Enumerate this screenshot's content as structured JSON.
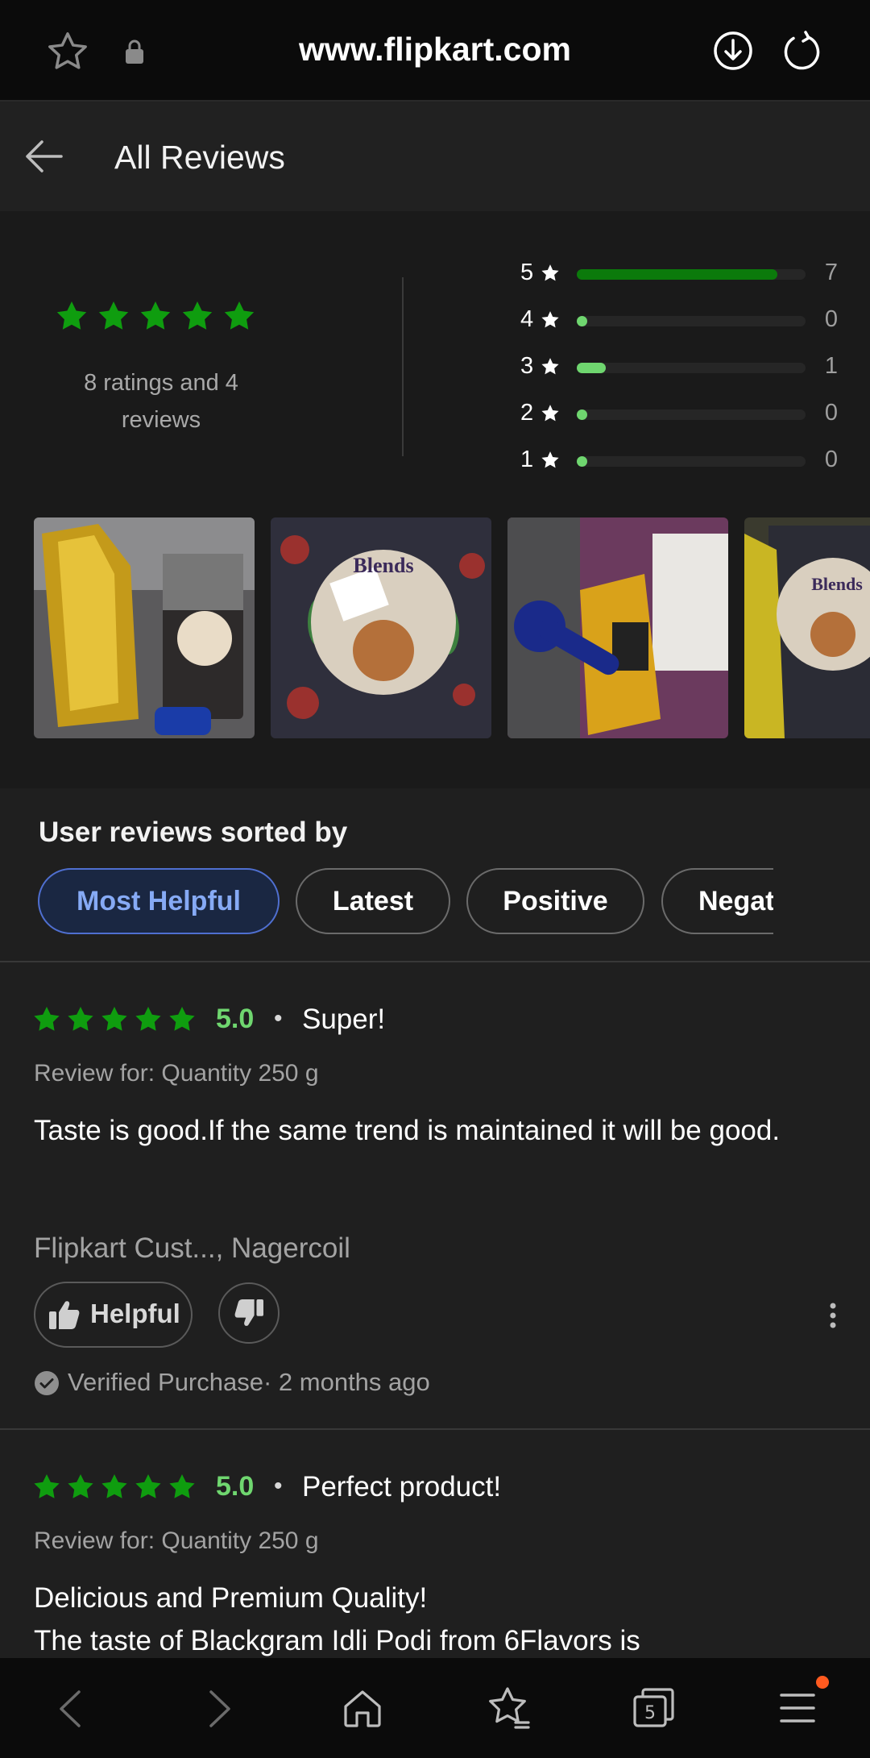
{
  "browser": {
    "url": "www.flipkart.com",
    "notification_color": "#ff5a1f"
  },
  "header": {
    "title": "All Reviews"
  },
  "summary": {
    "stars": 5,
    "caption_line1": "8 ratings and 4",
    "caption_line2": "reviews",
    "distribution": [
      {
        "star": "5",
        "count": "7",
        "fraction": 0.875,
        "color": "#0b7a0b"
      },
      {
        "star": "4",
        "count": "0",
        "fraction": 0,
        "color": "#6fd66f"
      },
      {
        "star": "3",
        "count": "1",
        "fraction": 0.125,
        "color": "#6fd66f"
      },
      {
        "star": "2",
        "count": "0",
        "fraction": 0,
        "color": "#6fd66f"
      },
      {
        "star": "1",
        "count": "0",
        "fraction": 0,
        "color": "#6fd66f"
      }
    ]
  },
  "sort": {
    "title": "User reviews sorted by",
    "options": [
      "Most Helpful",
      "Latest",
      "Positive",
      "Negative"
    ],
    "selected": "Most Helpful"
  },
  "reviews": [
    {
      "rating": "5.0",
      "title": "Super!",
      "variant": "Review for: Quantity 250 g",
      "body": "Taste is good.If the same trend is maintained it will be good.",
      "author": "Flipkart Cust..., Nagercoil",
      "helpful_label": "Helpful",
      "verified": "Verified Purchase· 2 months ago"
    },
    {
      "rating": "5.0",
      "title": "Perfect product!",
      "variant": "Review for: Quantity 250 g",
      "body_line1": "Delicious and Premium Quality!",
      "body_line2": "The taste of Blackgram Idli Podi from 6Flavors is"
    }
  ],
  "colors": {
    "star_green": "#0f9d0f",
    "rating_green": "#6fd66f",
    "selected_chip": "#86aaf5"
  }
}
